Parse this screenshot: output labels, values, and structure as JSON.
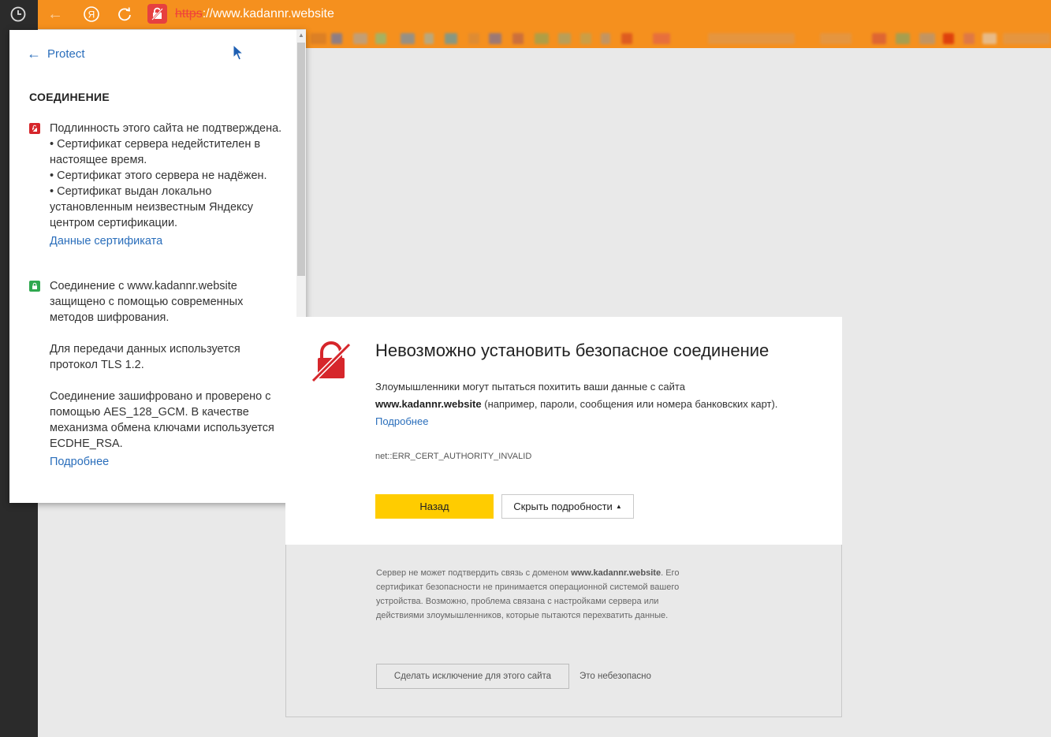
{
  "toolbar": {
    "url_protocol": "https",
    "url_rest": "://www.kadannr.website",
    "ya_glyph": "Я"
  },
  "popup": {
    "back_label": "Protect",
    "heading": "СОЕДИНЕНИЕ",
    "warning": {
      "line1": "Подлинность этого сайта не подтверждена.",
      "bullet1": " • Сертификат сервера недейстителен в настоящее время.",
      "bullet2": " • Сертификат этого сервера не надёжен.",
      "bullet3": " • Сертификат выдан локально установленным неизвестным Яндексу центром сертификации.",
      "link": "Данные сертификата"
    },
    "secure": {
      "p1": "Соединение с www.kadannr.website защищено с помощью современных методов шифрования.",
      "p2": "Для передачи данных используется протокол TLS 1.2.",
      "p3": "Соединение зашифровано и проверено с помощью AES_128_GCM. В качестве механизма обмена ключами используется ECDHE_RSA.",
      "link": "Подробнее"
    }
  },
  "error": {
    "title": "Невозможно установить безопасное соединение",
    "desc_prefix": "Злоумышленники могут пытаться похитить ваши данные с сайта",
    "desc_domain": "www.kadannr.website",
    "desc_suffix": " (например, пароли, сообщения или номера банковских карт).",
    "more_link": "Подробнее",
    "code": "net::ERR_CERT_AUTHORITY_INVALID",
    "back_button": "Назад",
    "hide_button": "Скрыть подробности",
    "details_prefix": "Сервер не может подтвердить связь с доменом ",
    "details_domain": "www.kadannr.website",
    "details_suffix": ". Его сертификат безопасности не принимается операционной системой вашего устройства. Возможно, проблема связана с настройками сервера или действиями злоумышленников, которые пытаются перехватить данные.",
    "exception_button": "Сделать исключение для этого сайта",
    "unsafe_note": "Это небезопасно"
  },
  "colors": {
    "toolbar": "#f5901e",
    "accent_link": "#2a6ebb",
    "danger": "#d6262b",
    "ok": "#2fa84f",
    "primary_button": "#ffcc00"
  }
}
